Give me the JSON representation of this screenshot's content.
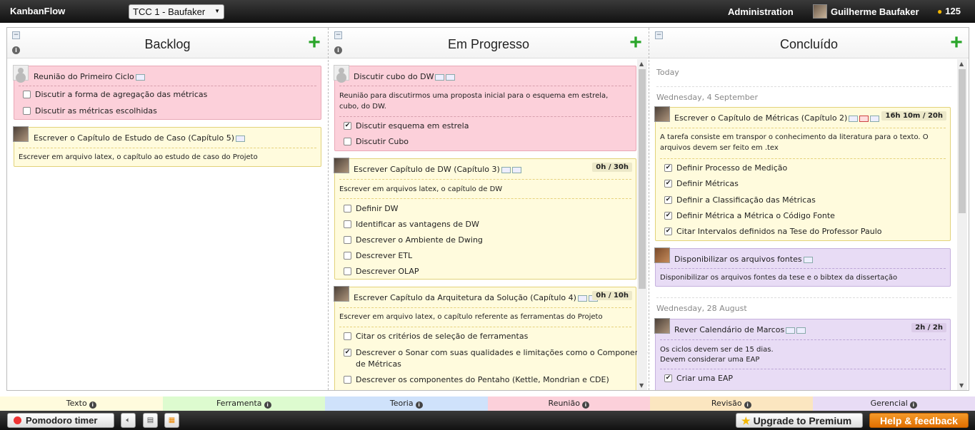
{
  "topbar": {
    "logo": "KanbanFlow",
    "board": "TCC 1 - Baufaker",
    "admin": "Administration",
    "user": "Guilherme Baufaker",
    "points": "125"
  },
  "columns": [
    {
      "title": "Backlog"
    },
    {
      "title": "Em Progresso"
    },
    {
      "title": "Concluído"
    }
  ],
  "backlog": {
    "t1": {
      "title": "Reunião do Primeiro Ciclo",
      "subs": [
        "Discutir a forma de agregação das métricas",
        "Discutir as métricas escolhidas"
      ]
    },
    "t2": {
      "title": "Escrever o Capítulo de Estudo de Caso (Capítulo 5)",
      "desc": "Escrever em arquivo latex, o capítulo ao estudo de caso do Projeto"
    }
  },
  "progress": {
    "t1": {
      "title": "Discutir cubo do DW",
      "desc": "Reunião para discutirmos uma proposta inicial para o esquema em estrela, cubo, do DW.",
      "subs": [
        "Discutir esquema em estrela",
        "Discutir Cubo"
      ]
    },
    "t2": {
      "title": "Escrever Capítulo de DW (Capítulo 3)",
      "badge": "0h / 30h",
      "desc": "Escrever em arquivos latex, o capítulo de DW",
      "subs": [
        "Definir DW",
        "Identificar as vantagens de DW",
        "Descrever o Ambiente de Dwing",
        "Descrever ETL",
        "Descrever OLAP"
      ]
    },
    "t3": {
      "title": "Escrever Capítulo da Arquitetura da Solução (Capítulo 4)",
      "badge": "0h / 10h",
      "desc": "Escrever em arquivo latex, o capítulo referente as ferramentas do Projeto",
      "subs": [
        "Citar os critérios de seleção de ferramentas",
        "Descrever o Sonar com suas qualidades e limitações como o Componente",
        "de Métricas",
        "Descrever os componentes do Pentaho (Kettle, Mondrian e CDE)"
      ]
    }
  },
  "done": {
    "today": "Today",
    "day1": "Wednesday, 4 September",
    "t1": {
      "title": "Escrever o Capítulo de Métricas (Capítulo 2)",
      "badge": "16h 10m / 20h",
      "desc": "A tarefa consiste em transpor o conhecimento da literatura para o texto. O arquivos devem ser feito em .tex",
      "subs": [
        "Definir Processo de Medição",
        "Definir Métricas",
        "Definir a Classificação das Métricas",
        "Definir Métrica a Métrica o Código Fonte",
        "Citar Intervalos definidos na Tese do Professor Paulo"
      ]
    },
    "t2": {
      "title": "Disponibilizar os arquivos fontes",
      "desc": "Disponibilizar os arquivos fontes da tese e o bibtex da dissertação"
    },
    "day2": "Wednesday, 28 August",
    "t3": {
      "title": "Rever Calendário de Marcos",
      "badge": "2h / 2h",
      "desc1": "Os ciclos devem ser de 15 dias.",
      "desc2": "Devem considerar uma EAP",
      "subs": [
        "Criar uma EAP"
      ]
    }
  },
  "legend": [
    "Texto",
    "Ferramenta",
    "Teoria",
    "Reunião",
    "Revisão",
    "Gerencial"
  ],
  "colors": {
    "texto": "#fffbdd",
    "ferramenta": "#ddfbcf",
    "teoria": "#cfe2fb",
    "reuniao": "#fcd0da",
    "revisao": "#fbe6c0",
    "gerencial": "#e8dcf5"
  },
  "bottom": {
    "pomodoro": "Pomodoro timer",
    "upgrade": "Upgrade to Premium",
    "help": "Help & feedback"
  }
}
